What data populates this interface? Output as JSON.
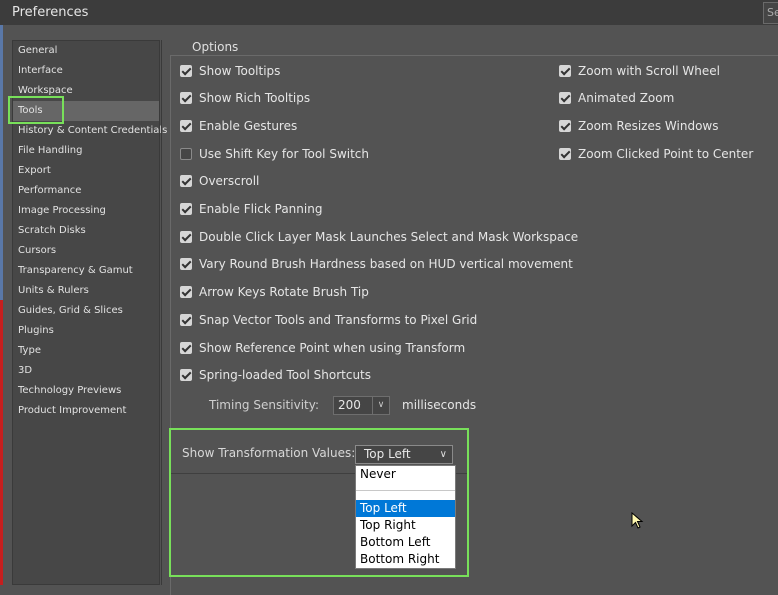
{
  "window": {
    "title": "Preferences",
    "search_placeholder": "Se"
  },
  "sidebar": {
    "items": [
      {
        "label": "General"
      },
      {
        "label": "Interface"
      },
      {
        "label": "Workspace"
      },
      {
        "label": "Tools"
      },
      {
        "label": "History & Content Credentials"
      },
      {
        "label": "File Handling"
      },
      {
        "label": "Export"
      },
      {
        "label": "Performance"
      },
      {
        "label": "Image Processing"
      },
      {
        "label": "Scratch Disks"
      },
      {
        "label": "Cursors"
      },
      {
        "label": "Transparency & Gamut"
      },
      {
        "label": "Units & Rulers"
      },
      {
        "label": "Guides, Grid & Slices"
      },
      {
        "label": "Plugins"
      },
      {
        "label": "Type"
      },
      {
        "label": "3D"
      },
      {
        "label": "Technology Previews"
      },
      {
        "label": "Product Improvement"
      }
    ],
    "selected": "Tools"
  },
  "options": {
    "legend": "Options",
    "left_checkboxes": [
      {
        "label": "Show Tooltips",
        "checked": true
      },
      {
        "label": "Show Rich Tooltips",
        "checked": true
      },
      {
        "label": "Enable Gestures",
        "checked": true
      },
      {
        "label": "Use Shift Key for Tool Switch",
        "checked": false
      },
      {
        "label": "Overscroll",
        "checked": true
      },
      {
        "label": "Enable Flick Panning",
        "checked": true
      },
      {
        "label": "Double Click Layer Mask Launches Select and Mask Workspace",
        "checked": true
      },
      {
        "label": "Vary Round Brush Hardness based on HUD vertical movement",
        "checked": true
      },
      {
        "label": "Arrow Keys Rotate Brush Tip",
        "checked": true
      },
      {
        "label": "Snap Vector Tools and Transforms to Pixel Grid",
        "checked": true
      },
      {
        "label": "Show Reference Point when using Transform",
        "checked": true
      },
      {
        "label": "Spring-loaded Tool Shortcuts",
        "checked": true
      }
    ],
    "right_checkboxes": [
      {
        "label": "Zoom with Scroll Wheel",
        "checked": true
      },
      {
        "label": "Animated Zoom",
        "checked": true
      },
      {
        "label": "Zoom Resizes Windows",
        "checked": true
      },
      {
        "label": "Zoom Clicked Point to Center",
        "checked": true
      }
    ],
    "timing": {
      "label": "Timing Sensitivity:",
      "value": "200",
      "unit": "milliseconds"
    }
  },
  "transformation": {
    "label": "Show Transformation Values:",
    "selected": "Top Left",
    "options": [
      "Never",
      "",
      "Top Left",
      "Top Right",
      "Bottom Left",
      "Bottom Right"
    ]
  },
  "colors": {
    "highlight_green": "#78e05a",
    "selection_blue": "#0078d7",
    "panel_bg": "#535353"
  }
}
